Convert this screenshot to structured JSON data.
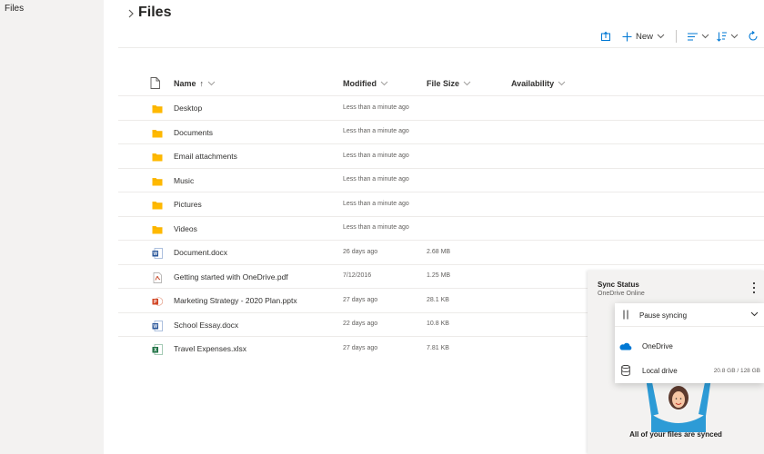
{
  "nav": {
    "files_label": "Files"
  },
  "header": {
    "title": "Files"
  },
  "toolbar": {
    "new_label": "New"
  },
  "columns": {
    "name": "Name",
    "name_sort": "↑",
    "modified": "Modified",
    "file_size": "File Size",
    "availability": "Availability"
  },
  "files": [
    {
      "name": "Desktop",
      "type": "folder",
      "modified": "Less than a minute ago",
      "size": ""
    },
    {
      "name": "Documents",
      "type": "folder",
      "modified": "Less than a minute ago",
      "size": ""
    },
    {
      "name": "Email attachments",
      "type": "folder",
      "modified": "Less than a minute ago",
      "size": ""
    },
    {
      "name": "Music",
      "type": "folder",
      "modified": "Less than a minute ago",
      "size": ""
    },
    {
      "name": "Pictures",
      "type": "folder",
      "modified": "Less than a minute ago",
      "size": ""
    },
    {
      "name": "Videos",
      "type": "folder",
      "modified": "Less than a minute ago",
      "size": ""
    },
    {
      "name": "Document.docx",
      "type": "word",
      "modified": "26 days ago",
      "size": "2.68 MB"
    },
    {
      "name": "Getting started with OneDrive.pdf",
      "type": "pdf",
      "modified": "7/12/2016",
      "size": "1.25 MB"
    },
    {
      "name": "Marketing Strategy - 2020 Plan.pptx",
      "type": "powerpoint",
      "modified": "27 days ago",
      "size": "28.1 KB"
    },
    {
      "name": "School Essay.docx",
      "type": "word",
      "modified": "22 days ago",
      "size": "10.8 KB"
    },
    {
      "name": "Travel Expenses.xlsx",
      "type": "excel",
      "modified": "27 days ago",
      "size": "7.81 KB"
    }
  ],
  "sync": {
    "title": "Sync Status",
    "subtitle": "OneDrive Online",
    "pause_label": "Pause syncing",
    "onedrive_label": "OneDrive",
    "local_label": "Local drive",
    "local_size": "20.8 GB / 128 GB",
    "message": "All of your files are synced"
  },
  "colors": {
    "accent": "#0078d4",
    "folder": "#ffb900",
    "word": "#2b579a",
    "excel": "#217346",
    "powerpoint": "#d24726",
    "pdf": "#c43e1c"
  }
}
